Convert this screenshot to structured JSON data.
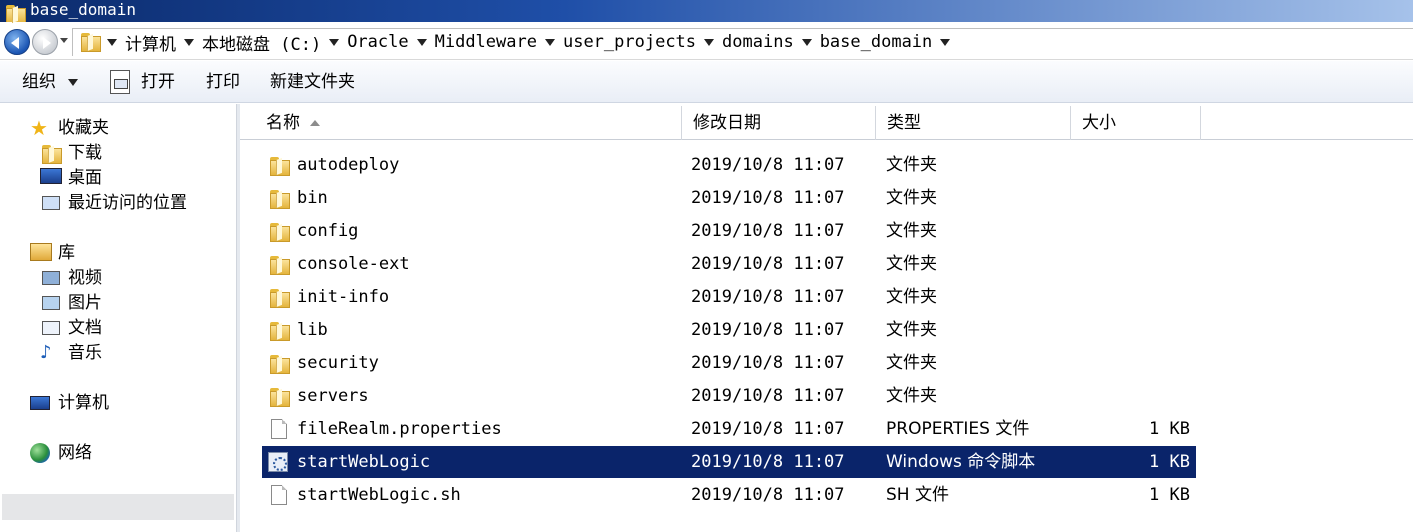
{
  "window": {
    "title": "base_domain"
  },
  "address": {
    "crumbs": [
      "计算机",
      "本地磁盘 (C:)",
      "Oracle",
      "Middleware",
      "user_projects",
      "domains",
      "base_domain"
    ]
  },
  "toolbar": {
    "organize": "组织",
    "open": "打开",
    "print": "打印",
    "new_folder": "新建文件夹"
  },
  "nav": {
    "favorites": "收藏夹",
    "downloads": "下载",
    "desktop": "桌面",
    "recent": "最近访问的位置",
    "libraries": "库",
    "videos": "视频",
    "pictures": "图片",
    "documents": "文档",
    "music": "音乐",
    "computer": "计算机",
    "network": "网络"
  },
  "columns": {
    "name": "名称",
    "date": "修改日期",
    "type": "类型",
    "size": "大小"
  },
  "files": [
    {
      "name": "autodeploy",
      "date": "2019/10/8 11:07",
      "type": "文件夹",
      "size": "",
      "icon": "folder-icon"
    },
    {
      "name": "bin",
      "date": "2019/10/8 11:07",
      "type": "文件夹",
      "size": "",
      "icon": "folder-icon"
    },
    {
      "name": "config",
      "date": "2019/10/8 11:07",
      "type": "文件夹",
      "size": "",
      "icon": "folder-icon"
    },
    {
      "name": "console-ext",
      "date": "2019/10/8 11:07",
      "type": "文件夹",
      "size": "",
      "icon": "folder-icon"
    },
    {
      "name": "init-info",
      "date": "2019/10/8 11:07",
      "type": "文件夹",
      "size": "",
      "icon": "folder-icon"
    },
    {
      "name": "lib",
      "date": "2019/10/8 11:07",
      "type": "文件夹",
      "size": "",
      "icon": "folder-icon"
    },
    {
      "name": "security",
      "date": "2019/10/8 11:07",
      "type": "文件夹",
      "size": "",
      "icon": "folder-icon"
    },
    {
      "name": "servers",
      "date": "2019/10/8 11:07",
      "type": "文件夹",
      "size": "",
      "icon": "folder-icon"
    },
    {
      "name": "fileRealm.properties",
      "date": "2019/10/8 11:07",
      "type": "PROPERTIES 文件",
      "size": "1 KB",
      "icon": "document-icon"
    },
    {
      "name": "startWebLogic",
      "date": "2019/10/8 11:07",
      "type": "Windows 命令脚本",
      "size": "1 KB",
      "icon": "script-icon"
    },
    {
      "name": "startWebLogic.sh",
      "date": "2019/10/8 11:07",
      "type": "SH 文件",
      "size": "1 KB",
      "icon": "document-icon"
    }
  ],
  "selected_index": 9,
  "colors": {
    "selection": "#0a246a",
    "titlebar": "#0b2a6b"
  }
}
